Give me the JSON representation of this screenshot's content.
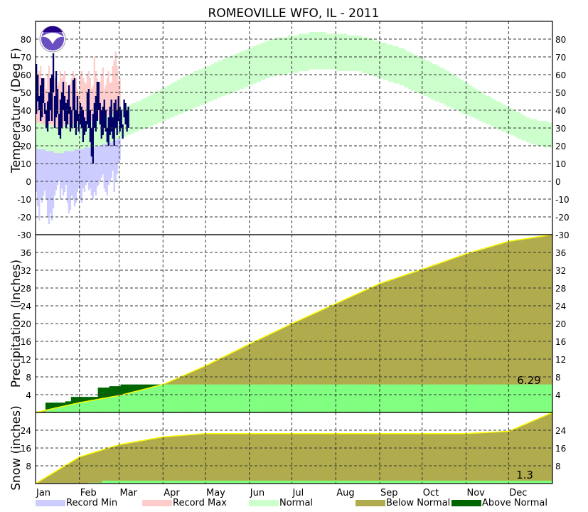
{
  "chart_data": {
    "type": "area",
    "title": "ROMEOVILLE  WFO, IL - 2011",
    "months": [
      "Jan",
      "Feb",
      "Mar",
      "Apr",
      "May",
      "Jun",
      "Jul",
      "Aug",
      "Sep",
      "Oct",
      "Nov",
      "Dec"
    ],
    "month_start_days": [
      0,
      31,
      59,
      90,
      120,
      151,
      181,
      212,
      243,
      273,
      304,
      334,
      365
    ],
    "legend": [
      {
        "label": "Record Min",
        "color": "#ccccff"
      },
      {
        "label": "Record Max",
        "color": "#ffcccc"
      },
      {
        "label": "Normal",
        "color": "#ccffcc"
      },
      {
        "label": "Below Normal",
        "color": "#b0ac4e"
      },
      {
        "label": "Above Normal",
        "color": "#006600"
      }
    ],
    "colors": {
      "observed": "#000066",
      "precip_obs": "#80ff80",
      "normal_line": "#ffff00"
    },
    "temperature": {
      "ylabel": "Temperature (Deg F)",
      "ylim": [
        -30,
        90
      ],
      "ticks": [
        -30,
        -20,
        -10,
        0,
        10,
        20,
        30,
        40,
        50,
        60,
        70,
        80
      ],
      "normal_high_monthly_mid": [
        31,
        35,
        46,
        59,
        70,
        80,
        84,
        82,
        75,
        63,
        48,
        35
      ],
      "normal_low_monthly_mid": [
        16,
        20,
        29,
        39,
        49,
        59,
        63,
        62,
        54,
        43,
        32,
        21
      ],
      "observed_high": [
        66,
        60,
        48,
        54,
        58,
        58,
        44,
        40,
        45,
        50,
        58,
        60,
        72,
        48,
        62,
        52,
        38,
        46,
        50,
        56,
        48,
        44,
        46,
        54,
        42,
        40,
        57,
        58,
        40,
        48,
        38,
        44,
        42,
        40,
        36,
        34,
        50,
        52,
        40,
        30,
        38,
        44,
        48,
        56,
        56,
        44,
        40,
        42,
        46,
        40,
        30,
        36,
        42,
        46,
        36,
        44,
        46,
        40,
        48,
        42,
        40,
        32,
        46,
        44,
        40,
        42
      ],
      "observed_low": [
        38,
        45,
        40,
        34,
        36,
        44,
        38,
        30,
        28,
        34,
        40,
        34,
        50,
        30,
        36,
        38,
        26,
        24,
        30,
        40,
        34,
        30,
        32,
        38,
        28,
        30,
        40,
        30,
        26,
        34,
        28,
        32,
        30,
        22,
        26,
        28,
        32,
        30,
        22,
        14,
        10,
        30,
        28,
        34,
        40,
        32,
        24,
        26,
        30,
        28,
        22,
        20,
        26,
        28,
        24,
        20,
        30,
        26,
        34,
        28,
        30,
        24,
        36,
        32,
        28,
        30
      ],
      "record_max": [
        64,
        60,
        62,
        65,
        56,
        50,
        58,
        52,
        60,
        65,
        58,
        55,
        62,
        58,
        52,
        54,
        56,
        62,
        58,
        60,
        62,
        56,
        50,
        52,
        55,
        58,
        62,
        60,
        58,
        52,
        50,
        60,
        62,
        58,
        56,
        55,
        60,
        62,
        58,
        52,
        54,
        70,
        62,
        58,
        55,
        56,
        60,
        64,
        52,
        54,
        58,
        62,
        55,
        56,
        65,
        68,
        73,
        65,
        56,
        58
      ],
      "record_min": [
        -6,
        -14,
        -22,
        -10,
        -12,
        -8,
        -5,
        -10,
        -20,
        -24,
        -18,
        -22,
        -15,
        -8,
        -5,
        -2,
        0,
        -10,
        -4,
        -8,
        -6,
        -2,
        -12,
        -18,
        -16,
        -8,
        -10,
        -14,
        -12,
        -6,
        -4,
        -10,
        -12,
        -4,
        -6,
        -2,
        0,
        -5,
        -4,
        -8,
        -10,
        -6,
        -8,
        -3,
        -2,
        0,
        2,
        4,
        -4,
        -6,
        -8,
        -2,
        0,
        2,
        6,
        -6,
        0,
        4,
        10,
        12
      ]
    },
    "precipitation": {
      "ylabel": "Precipitation (Inches)",
      "ylim": [
        0,
        40
      ],
      "ticks": [
        4,
        8,
        12,
        16,
        20,
        24,
        28,
        32,
        36
      ],
      "normal_cumulative_month_start": [
        0,
        2.2,
        3.8,
        6.3,
        10.5,
        15.4,
        20,
        24.5,
        29,
        32.2,
        35.7,
        38.5,
        40
      ],
      "observed_steps": [
        [
          0,
          0
        ],
        [
          7,
          2.2
        ],
        [
          21,
          2.5
        ],
        [
          25,
          3.5
        ],
        [
          44,
          5.6
        ],
        [
          52,
          5.9
        ],
        [
          60,
          6.29
        ]
      ],
      "total_label": "6.29"
    },
    "snow": {
      "ylabel": "Snow (inches)",
      "ylim": [
        0,
        32
      ],
      "ticks": [
        8,
        16,
        24
      ],
      "normal_cumulative_month_start": [
        0,
        12,
        17.5,
        21,
        22.5,
        22.5,
        22.5,
        22.5,
        22.5,
        22.5,
        22.5,
        23.5,
        32
      ],
      "observed_steps": [
        [
          0,
          0
        ],
        [
          37,
          0.4
        ],
        [
          47,
          1.3
        ]
      ],
      "total_label": "1.3"
    }
  }
}
